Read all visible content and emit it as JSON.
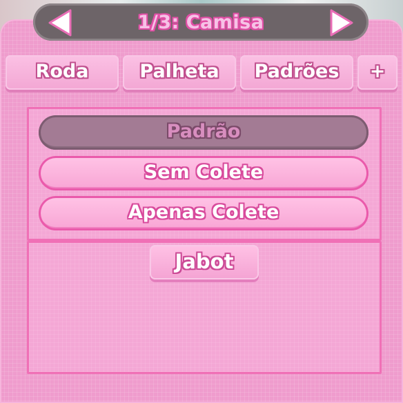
{
  "header": {
    "title": "1/3: Camisa",
    "prev_icon": "arrow-left-icon",
    "next_icon": "arrow-right-icon"
  },
  "tabs": [
    {
      "label": "Roda"
    },
    {
      "label": "Palheta"
    },
    {
      "label": "Padrões"
    },
    {
      "label": "+"
    }
  ],
  "styles": {
    "options": [
      {
        "label": "Padrão",
        "selected": true
      },
      {
        "label": "Sem Colete",
        "selected": false
      },
      {
        "label": "Apenas Colete",
        "selected": false
      }
    ]
  },
  "accessories": {
    "items": [
      {
        "label": "Jabot"
      }
    ]
  },
  "colors": {
    "panel": "#ef9ccd",
    "accent": "#e24fa6",
    "selected": "#a37b94"
  }
}
